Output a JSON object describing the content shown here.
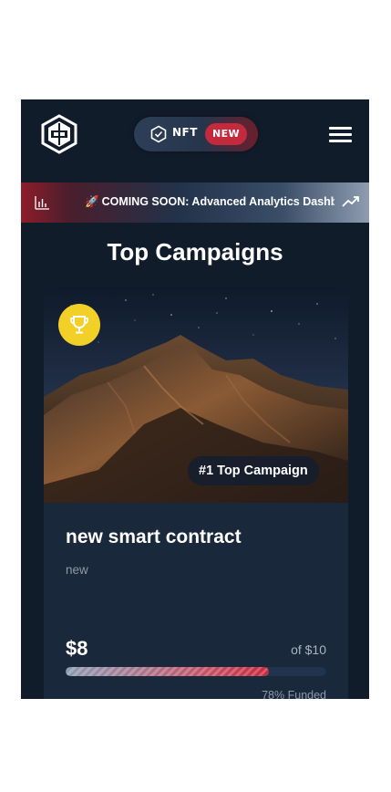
{
  "header": {
    "nft_label": "NFT",
    "new_badge": "NEW"
  },
  "ticker": {
    "text": "COMING SOON: Advanced Analytics Dashboard"
  },
  "section": {
    "title": "Top Campaigns"
  },
  "campaign": {
    "badge": "#1 Top Campaign",
    "title": "new smart contract",
    "subtitle": "new",
    "raised": "$8",
    "goal": "of $10",
    "funded_fraction": 0.78,
    "funded_label": "78% Funded"
  },
  "colors": {
    "background": "#111c2b",
    "card": "#1a283b",
    "accent_red": "#c32a3d",
    "trophy_yellow": "#f2d027"
  },
  "icons": {
    "logo": "hexagon-logo-icon",
    "nft": "hexagon-nft-icon",
    "menu": "hamburger-menu-icon",
    "ticker_left": "bar-chart-icon",
    "ticker_right": "trending-up-icon",
    "trophy": "trophy-icon"
  }
}
